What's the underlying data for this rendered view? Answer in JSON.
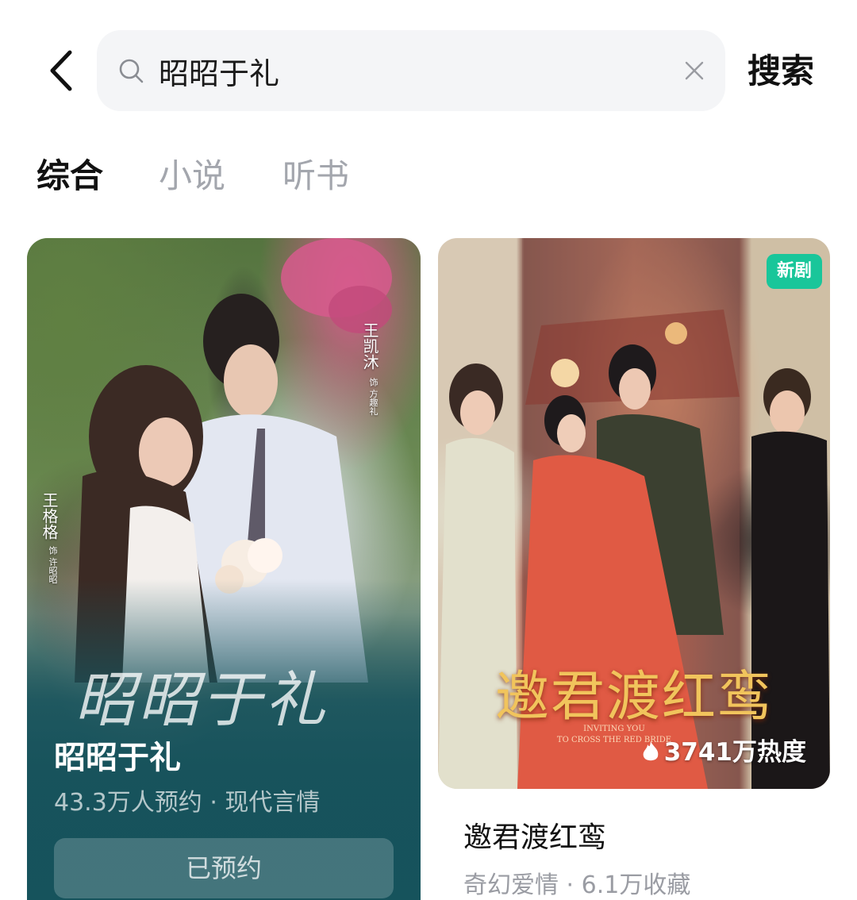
{
  "search": {
    "query": "昭昭于礼",
    "submit_label": "搜索"
  },
  "tabs": [
    {
      "label": "综合",
      "active": true
    },
    {
      "label": "小说",
      "active": false
    },
    {
      "label": "听书",
      "active": false
    }
  ],
  "results": [
    {
      "title": "昭昭于礼",
      "meta": "43.3万人预约 · 现代言情",
      "button_label": "已预约",
      "poster_text": {
        "calligraphy": "昭昭于礼",
        "actor_1": "王凯沐",
        "actor_1_role": "饰 方趣礼",
        "actor_2": "王格格",
        "actor_2_role": "饰 许昭昭"
      }
    },
    {
      "title": "邀君渡红鸾",
      "meta": "奇幻爱情 · 6.1万收藏",
      "badge": "新剧",
      "heat": "3741万热度",
      "poster_text": {
        "calligraphy": "邀君渡红鸾",
        "english_1": "INVITING YOU",
        "english_2": "TO CROSS THE RED BRIDE"
      }
    }
  ],
  "colors": {
    "badge_green": "#19c69a",
    "poster_gold": "#f1c45c",
    "tab_inactive": "#a3a6ad"
  }
}
